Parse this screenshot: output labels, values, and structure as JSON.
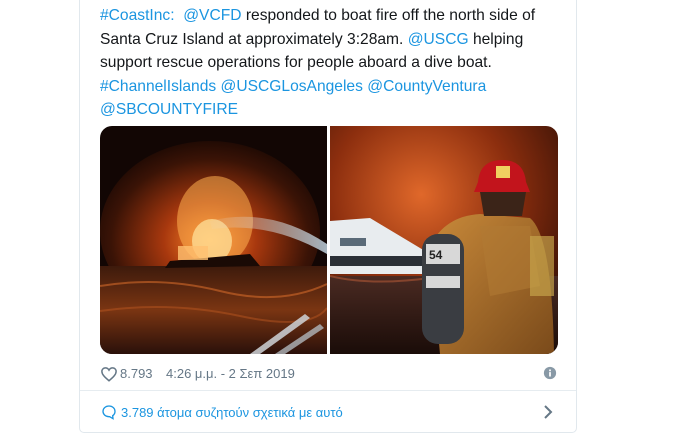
{
  "tweet": {
    "hashtag_coastinc": "#CoastInc:",
    "mention_vcfd": "@VCFD",
    "text_1": "responded to boat fire off the north side of Santa Cruz Island at approximately 3:28am.",
    "mention_uscg": "@USCG",
    "text_2": "helping support rescue operations for people aboard a dive boat.",
    "hashtag_channelislands": "#ChannelIslands",
    "mention_uscglosangeles": "@USCGLosAngeles",
    "mention_countyventura": "@CountyVentura",
    "mention_sbcountyfire": "@SBCOUNTYFIRE"
  },
  "media": {
    "left_photo": "boat-fire-water-spray",
    "right_photo": "firefighter-burning-boat"
  },
  "meta": {
    "likes": "8.793",
    "timestamp": "4:26 μ.μ. - 2 Σεπ 2019",
    "heart_icon": "heart-icon",
    "info_icon": "info-icon"
  },
  "conversation": {
    "label": "3.789 άτομα συζητούν σχετικά με αυτό",
    "icon": "speech-bubble-icon",
    "chevron": "chevron-right-icon"
  },
  "colors": {
    "link": "#1b95e0",
    "text": "#14171a",
    "muted": "#657786",
    "border": "#e1e8ed"
  }
}
